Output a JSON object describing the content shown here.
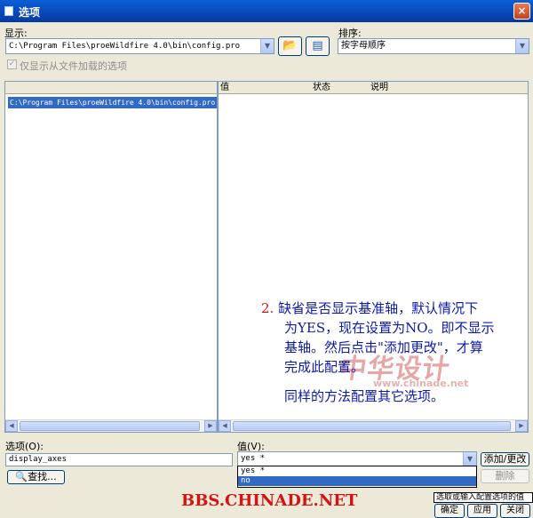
{
  "window": {
    "title": "选项",
    "close_glyph": "×"
  },
  "display": {
    "label": "显示:",
    "value": "C:\\Program Files\\proeWildfire 4.0\\bin\\config.pro",
    "open_icon": "folder-open-icon",
    "save_icon": "save-config-icon"
  },
  "sort": {
    "label": "排序:",
    "value": "按字母顺序"
  },
  "filter_checkbox": {
    "label": "仅显示从文件加载的选项",
    "checked": true
  },
  "tree": {
    "items": [
      "C:\\Program Files\\proeWildfire 4.0\\bin\\config.pro"
    ]
  },
  "columns": {
    "value": "值",
    "status": "状态",
    "description": "说明"
  },
  "annotation": {
    "number": "2.",
    "lines": [
      "缺省是否显示基准轴，默认情况下",
      "为YES，现在设置为NO。即不显示",
      "基轴。然后点击\"添加更改\"，才算",
      "完成此配置。"
    ],
    "extra": "同样的方法配置其它选项。"
  },
  "watermark": {
    "text": "中华设计",
    "url": "www.chinade.net"
  },
  "option": {
    "label": "选项(O):",
    "value": "display_axes",
    "find_button": "查找..."
  },
  "value_field": {
    "label": "值(V):",
    "value": "yes *",
    "options": [
      "yes *",
      "no"
    ],
    "selected_index": 1
  },
  "buttons": {
    "add_change": "添加/更改",
    "delete": "删除",
    "ok": "确定",
    "apply": "应用",
    "close": "关闭"
  },
  "footer": {
    "site": "BBS.CHINADE.NET",
    "status_tip": "选取或输入配置选项的值"
  },
  "colors": {
    "title_bar": "#0a5fd6",
    "selection": "#316ac5",
    "annotation_text": "#0c1aa8",
    "annotation_number": "#d21414"
  }
}
